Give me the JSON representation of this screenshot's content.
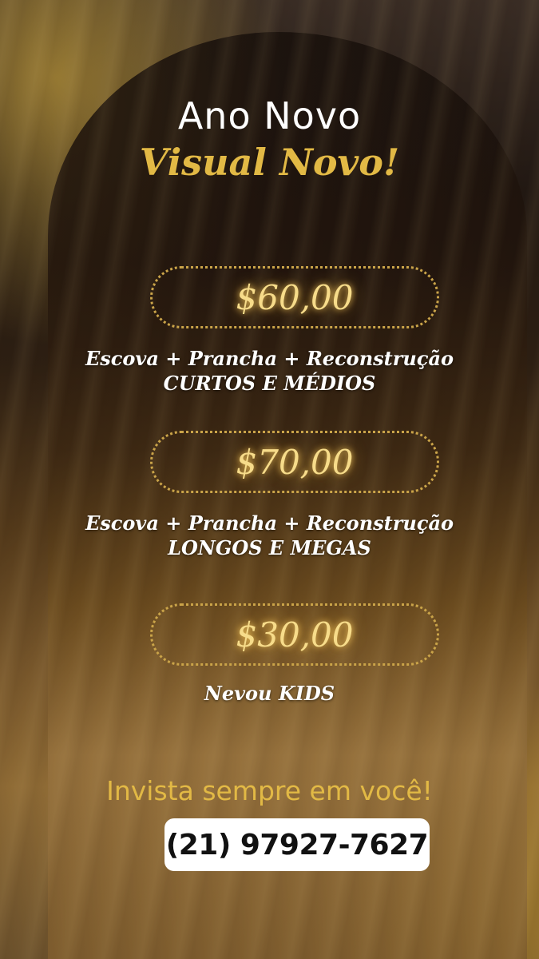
{
  "title": {
    "line1": "Ano Novo",
    "line2": "Visual Novo!"
  },
  "offers": [
    {
      "price": "$60,00",
      "desc_line1": "Escova + Prancha + Reconstrução",
      "desc_line2": "CURTOS E MÉDIOS"
    },
    {
      "price": "$70,00",
      "desc_line1": "Escova + Prancha + Reconstrução",
      "desc_line2": "LONGOS E MEGAS"
    },
    {
      "price": "$30,00",
      "desc_line1": "Nevou KIDS"
    }
  ],
  "slogan": "Invista sempre em você!",
  "phone": "(21) 97927-7627",
  "colors": {
    "gold": "#e2b945",
    "price_glow": "#f7dc8a",
    "text": "#ffffff",
    "phone_bg": "#ffffff"
  }
}
